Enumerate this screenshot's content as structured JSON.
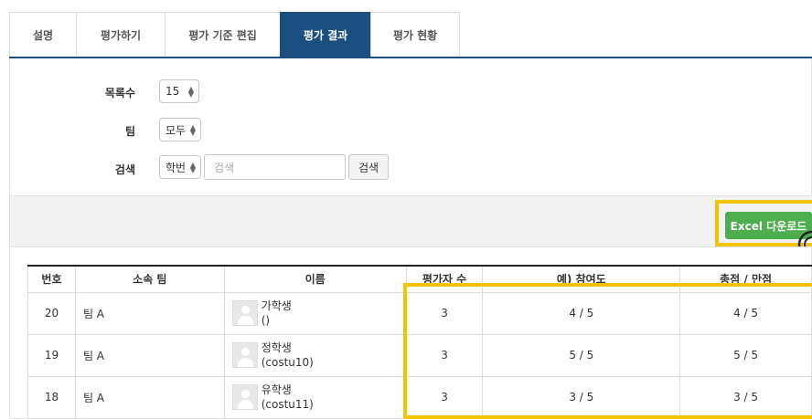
{
  "tabs": [
    {
      "label": "설명"
    },
    {
      "label": "평가하기"
    },
    {
      "label": "평가 기준 편집"
    },
    {
      "label": "평가 결과"
    },
    {
      "label": "평가 현황"
    }
  ],
  "filters": {
    "count": {
      "label": "목록수",
      "value": "15"
    },
    "team": {
      "label": "팀",
      "value": "모두"
    },
    "search": {
      "label": "검색",
      "field": "학번",
      "placeholder": "검색",
      "button": "검색"
    }
  },
  "excel_button": "Excel 다운로드",
  "table": {
    "headers": [
      "번호",
      "소속 팀",
      "이름",
      "평가자 수",
      "예) 참여도",
      "총점 / 만점"
    ],
    "rows": [
      {
        "no": "20",
        "team": "팀 A",
        "name": "가학생",
        "id": "()",
        "evaluators": "3",
        "participation": "4 / 5",
        "total": "4 / 5"
      },
      {
        "no": "19",
        "team": "팀 A",
        "name": "정학생",
        "id": "(costu10)",
        "evaluators": "3",
        "participation": "5 / 5",
        "total": "5 / 5"
      },
      {
        "no": "18",
        "team": "팀 A",
        "name": "유학생",
        "id": "(costu11)",
        "evaluators": "3",
        "participation": "3 / 5",
        "total": "3 / 5"
      }
    ]
  }
}
